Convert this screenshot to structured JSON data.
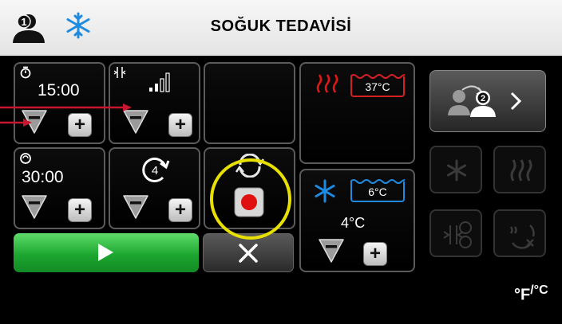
{
  "header": {
    "title": "SOĞUK TEDAVİSİ",
    "user_number": "1"
  },
  "timer_panel": {
    "value": "15:00"
  },
  "cycle_timer_panel": {
    "value": "30:00"
  },
  "cycles_panel": {
    "count": "4"
  },
  "heat_panel": {
    "temperature": "37°C"
  },
  "cold_panel": {
    "set_temperature": "6°C",
    "current_temperature": "4°C"
  },
  "switch_user": {
    "user_number": "2"
  },
  "units": {
    "main": "°F",
    "sub": "/°C"
  },
  "colors": {
    "accent_blue": "#1e8be0",
    "heat_red": "#d42020",
    "start_green": "#1da730",
    "annotation_yellow": "#e8e000",
    "arrow_red": "#c8162e"
  }
}
